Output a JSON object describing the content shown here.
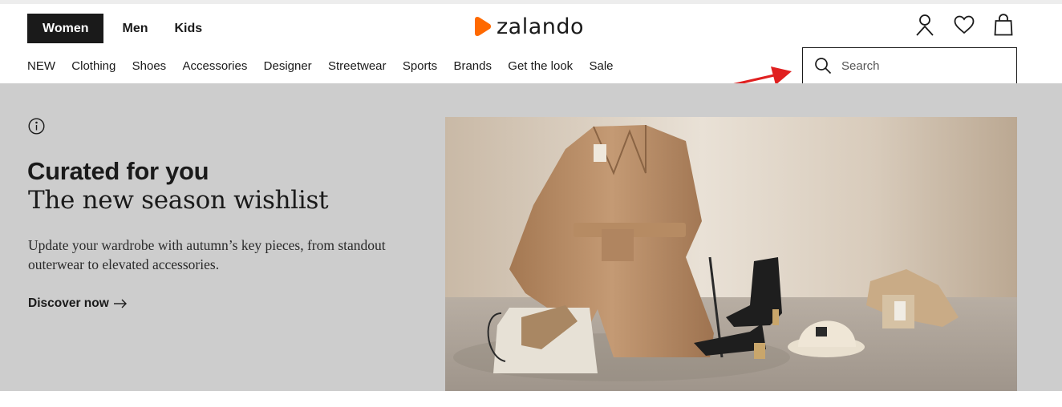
{
  "header": {
    "gender_tabs": [
      {
        "label": "Women",
        "active": true
      },
      {
        "label": "Men",
        "active": false
      },
      {
        "label": "Kids",
        "active": false
      }
    ],
    "logo_text": "zalando",
    "brand_color": "#ff6900",
    "icons": [
      "account-icon",
      "wishlist-heart-icon",
      "shopping-bag-icon"
    ]
  },
  "categories": [
    "NEW",
    "Clothing",
    "Shoes",
    "Accessories",
    "Designer",
    "Streetwear",
    "Sports",
    "Brands",
    "Get the look",
    "Sale"
  ],
  "search": {
    "placeholder": "Search",
    "value": ""
  },
  "annotation": {
    "arrow_color": "#e02020"
  },
  "hero": {
    "background": "#cdcdcd",
    "kicker": "Curated for you",
    "title": "The new season wishlist",
    "text": "Update your wardrobe with autumn’s key pieces, from standout outerwear to elevated accessories.",
    "cta": "Discover now"
  }
}
